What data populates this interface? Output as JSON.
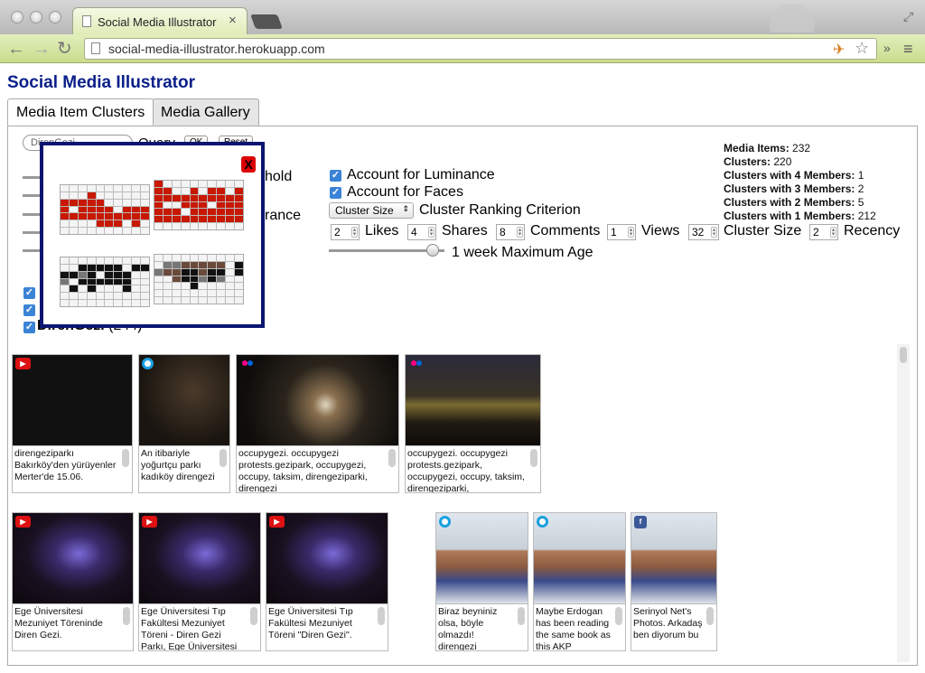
{
  "browser": {
    "tab_title": "Social Media Illustrator",
    "tab_close": "×",
    "url": "social-media-illustrator.herokuapp.com"
  },
  "page": {
    "title": "Social Media Illustrator",
    "tabs": [
      {
        "label": "Media Item Clusters",
        "active": true
      },
      {
        "label": "Media Gallery",
        "active": false
      }
    ]
  },
  "query": {
    "value": "DirenGezi",
    "label": "Query",
    "ok_label": "OK",
    "reset_label": "Reset"
  },
  "left_controls": {
    "threshold_suffix": "hold",
    "tolerance_suffix": "rance",
    "checked_query_label": "DirenGezi",
    "checked_query_count": "(244)"
  },
  "options": {
    "luminance_label": "Account for Luminance",
    "faces_label": "Account for Faces",
    "ranking_select_value": "Cluster Size",
    "ranking_label": "Cluster Ranking Criterion",
    "weights": [
      {
        "value": "2",
        "label": "Likes"
      },
      {
        "value": "4",
        "label": "Shares"
      },
      {
        "value": "8",
        "label": "Comments"
      },
      {
        "value": "1",
        "label": "Views"
      },
      {
        "value": "32",
        "label": "Cluster Size"
      },
      {
        "value": "2",
        "label": "Recency"
      }
    ],
    "max_age_label": "1 week Maximum Age",
    "max_age_fraction": 0.9
  },
  "stats": [
    {
      "label": "Media Items:",
      "value": "232"
    },
    {
      "label": "Clusters:",
      "value": "220"
    },
    {
      "label": "Clusters with 4 Members:",
      "value": "1"
    },
    {
      "label": "Clusters with 3 Members:",
      "value": "2"
    },
    {
      "label": "Clusters with 2 Members:",
      "value": "5"
    },
    {
      "label": "Clusters with 1 Members:",
      "value": "212"
    }
  ],
  "popup": {
    "close_label": "X"
  },
  "media_row1": [
    {
      "source": "youtube",
      "caption": "direngeziparkı Bakırköy'den yürüyenler Merter'de 15.06."
    },
    {
      "source": "camera",
      "caption": "An itibariyle yoğurtçu parkı kadıköy direngezi"
    },
    {
      "source": "flickr",
      "caption": "occupygezi. occupygezi protests.gezipark, occupygezi, occupy, taksim, direngeziparki, direngezi"
    },
    {
      "source": "flickr",
      "caption": "occupygezi. occupygezi protests.gezipark, occupygezi, occupy, taksim, direngeziparki,"
    }
  ],
  "media_row2_left": [
    {
      "source": "youtube",
      "caption": "Ege Üniversitesi Mezuniyet Töreninde Diren Gezi."
    },
    {
      "source": "youtube",
      "caption": "Ege Üniversitesi Tıp Fakültesi Mezuniyet Töreni - Diren Gezi Parkı, Ege Üniversitesi"
    },
    {
      "source": "youtube",
      "caption": "Ege Üniversitesi Tıp Fakültesi Mezuniyet Töreni \"Diren Gezi\"."
    }
  ],
  "media_row2_right": [
    {
      "source": "camera",
      "caption": "Biraz beyniniz olsa, böyle olmazdı! direngezi"
    },
    {
      "source": "camera",
      "caption": "Maybe Erdogan has been reading the same book as this AKP"
    },
    {
      "source": "facebook",
      "caption": "Serinyol Net's Photos. Arkadaş ben diyorum bu"
    }
  ],
  "colors": {
    "title": "#0a1f8a",
    "popup_border": "#0a1670",
    "mosaic_red": "#c81800"
  }
}
